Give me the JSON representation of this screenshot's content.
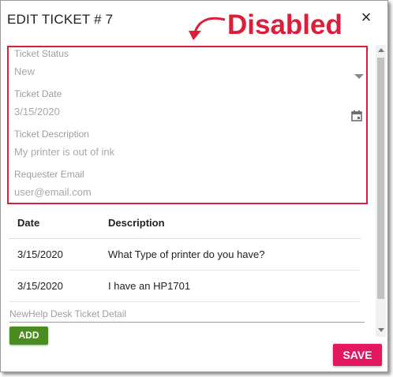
{
  "dialog": {
    "title": "EDIT TICKET # 7",
    "close_glyph": "×"
  },
  "annotation": {
    "text": "Disabled",
    "color": "#dc1e3a"
  },
  "fields": [
    {
      "label": "Ticket Status",
      "value": "New",
      "icon": "dropdown-caret-icon"
    },
    {
      "label": "Ticket Date",
      "value": "3/15/2020",
      "icon": "calendar-icon"
    },
    {
      "label": "Ticket Description",
      "value": "My printer is out of ink"
    },
    {
      "label": "Requester Email",
      "value": "user@email.com"
    }
  ],
  "detail_table": {
    "headers": [
      "Date",
      "Description"
    ],
    "rows": [
      [
        "3/15/2020",
        "What Type of printer do you have?"
      ],
      [
        "3/15/2020",
        "I have an HP1701"
      ]
    ]
  },
  "new_detail": {
    "placeholder": "NewHelp Desk Ticket Detail",
    "value": ""
  },
  "buttons": {
    "add_label": "ADD",
    "add_color": "#4a8c1f",
    "save_label": "SAVE",
    "save_color": "#e2175f"
  }
}
